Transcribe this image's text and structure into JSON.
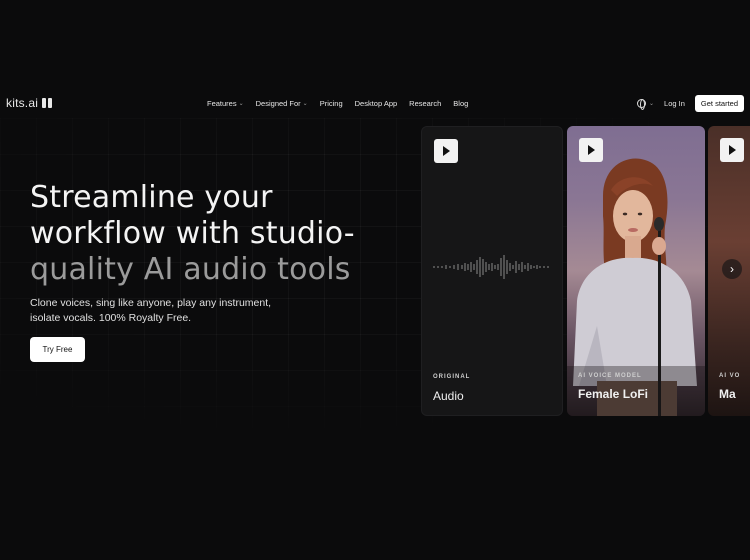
{
  "nav": {
    "logo_text": "kits.ai",
    "links": [
      {
        "label": "Features",
        "has_dropdown": true
      },
      {
        "label": "Designed For",
        "has_dropdown": true
      },
      {
        "label": "Pricing",
        "has_dropdown": false
      },
      {
        "label": "Desktop App",
        "has_dropdown": false
      },
      {
        "label": "Research",
        "has_dropdown": false
      },
      {
        "label": "Blog",
        "has_dropdown": false
      }
    ],
    "language_icon": "globe-icon",
    "login_label": "Log In",
    "get_started_label": "Get started"
  },
  "hero": {
    "title_line1": "Streamline your",
    "title_line2": "workflow with studio-",
    "title_line3a": "quality ",
    "title_line3b": "AI audio tools",
    "subtitle_line1": "Clone voices, sing like anyone, play any instrument,",
    "subtitle_line2": "isolate vocals. 100% Royalty Free.",
    "cta_label": "Try Free"
  },
  "cards": [
    {
      "tag": "ORIGINAL",
      "name": "Audio"
    },
    {
      "tag": "AI VOICE MODEL",
      "name": "Female LoFi"
    },
    {
      "tag": "AI VO",
      "name": "Ma"
    }
  ],
  "colors": {
    "background": "#0b0b0c",
    "button_bg": "#ffffff",
    "card_dark": "#161617"
  }
}
